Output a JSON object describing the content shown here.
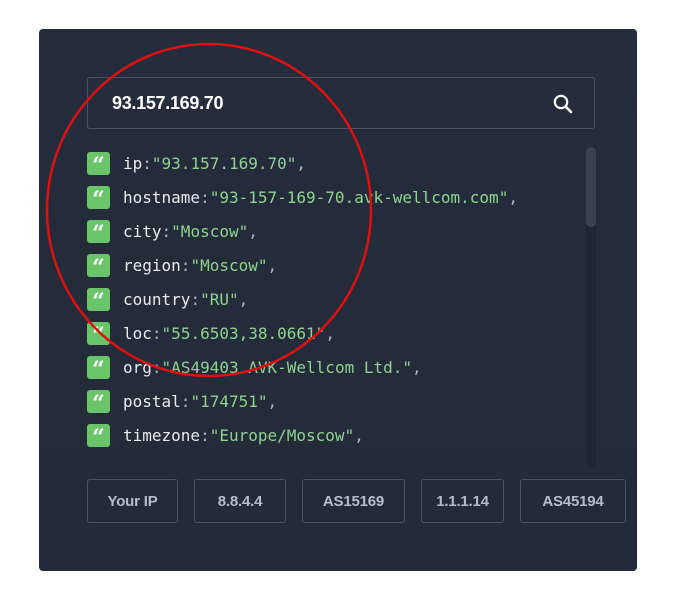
{
  "search": {
    "value": "93.157.169.70",
    "icon": "search-icon"
  },
  "json_rows": [
    {
      "key": "ip",
      "value": "\"93.157.169.70\""
    },
    {
      "key": "hostname",
      "value": "\"93-157-169-70.avk-wellcom.com\""
    },
    {
      "key": "city",
      "value": "\"Moscow\""
    },
    {
      "key": "region",
      "value": "\"Moscow\""
    },
    {
      "key": "country",
      "value": "\"RU\""
    },
    {
      "key": "loc",
      "value": "\"55.6503,38.0661\""
    },
    {
      "key": "org",
      "value": "\"AS49403 AVK-Wellcom Ltd.\""
    },
    {
      "key": "postal",
      "value": "\"174751\""
    },
    {
      "key": "timezone",
      "value": "\"Europe/Moscow\""
    }
  ],
  "punctuation": {
    "colon": ":",
    "comma": ",",
    "badge": "“"
  },
  "scroll": {
    "visible_fraction": 0.25
  },
  "quick_buttons": [
    {
      "label": "Your IP"
    },
    {
      "label": "8.8.4.4"
    },
    {
      "label": "AS15169"
    },
    {
      "label": "1.1.1.14"
    },
    {
      "label": "AS45194"
    }
  ],
  "colors": {
    "card_background": "#252d3c",
    "badge_green": "#6ac56a",
    "value_green": "#8fd38f",
    "annotation_red": "#e01010"
  }
}
